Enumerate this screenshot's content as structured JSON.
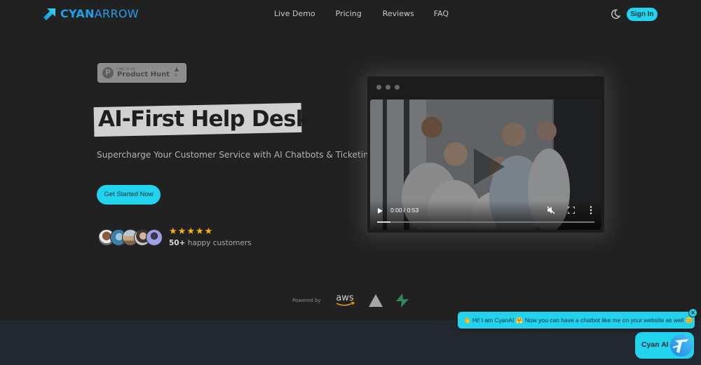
{
  "header": {
    "brand_bold": "CYAN",
    "brand_light": "ARROW",
    "logo_icon": "arrow-up-right-icon",
    "nav": [
      {
        "label": "Live Demo"
      },
      {
        "label": "Pricing"
      },
      {
        "label": "Reviews"
      },
      {
        "label": "FAQ"
      }
    ],
    "theme_toggle_icon": "moon-icon",
    "signin_label": "Sign In"
  },
  "product_hunt": {
    "small_text": "FIND US ON",
    "big_text": "Product Hunt",
    "letter": "P",
    "upvote_count": "9"
  },
  "hero": {
    "title": "AI-First Help Desk",
    "subtitle": "Supercharge Your Customer Service with AI Chatbots & Ticketing",
    "cta_label": "Get Started Now",
    "rating_stars": 5,
    "star_glyph": "★",
    "customers_count": "50+",
    "customers_text": " happy customers",
    "avatar_count": 5
  },
  "video": {
    "time": "0:00 / 0:53",
    "progress_percent": 6,
    "muted": true
  },
  "powered_by": {
    "label": "Powered by",
    "logos": [
      "aws",
      "vercel",
      "supabase"
    ],
    "aws_text": "aws"
  },
  "chat": {
    "bubble_text": "👋 Hi! I am CyanAI 🤗 Now you can have a chatbot like me on your website as well 😊",
    "close_label": "×",
    "launcher_label": "Cyan AI"
  },
  "colors": {
    "accent": "#22d3ee",
    "brand_blue": "#1fa3e8",
    "background": "#212121",
    "bottom_section": "#232730",
    "star": "#f5b50a"
  }
}
